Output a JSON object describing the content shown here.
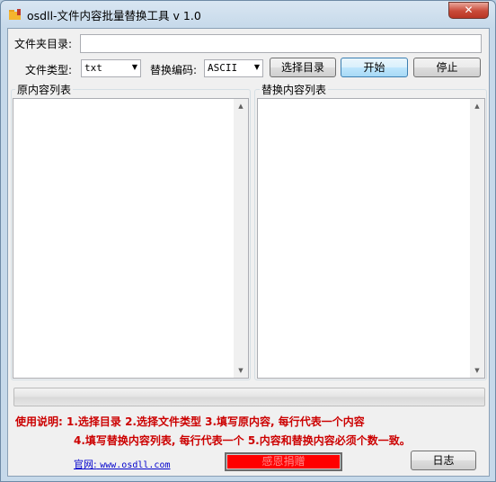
{
  "window": {
    "title": "osdll-文件内容批量替换工具 v 1.0",
    "close_label": "✕"
  },
  "form": {
    "folder_label": "文件夹目录:",
    "folder_value": "",
    "filetype_label": "文件类型:",
    "filetype_value": "txt",
    "encoding_label": "替换编码:",
    "encoding_value": "ASCII",
    "select_dir_label": "选择目录",
    "start_label": "开始",
    "stop_label": "停止"
  },
  "lists": {
    "original_title": "原内容列表",
    "replace_title": "替换内容列表"
  },
  "instructions": {
    "line1": "使用说明: 1.选择目录   2.选择文件类型   3.填写原内容, 每行代表一个内容",
    "line2": "4.填写替换内容列表, 每行代表一个   5.内容和替换内容必须个数一致。"
  },
  "footer": {
    "site_prefix": "官网:",
    "site_url": "www.osdll.com",
    "donate_label": "感恩捐赠",
    "log_label": "日志"
  },
  "colors": {
    "instruction_text": "#cc0000",
    "donate_bg": "#ff0000",
    "link": "#0000cc"
  }
}
